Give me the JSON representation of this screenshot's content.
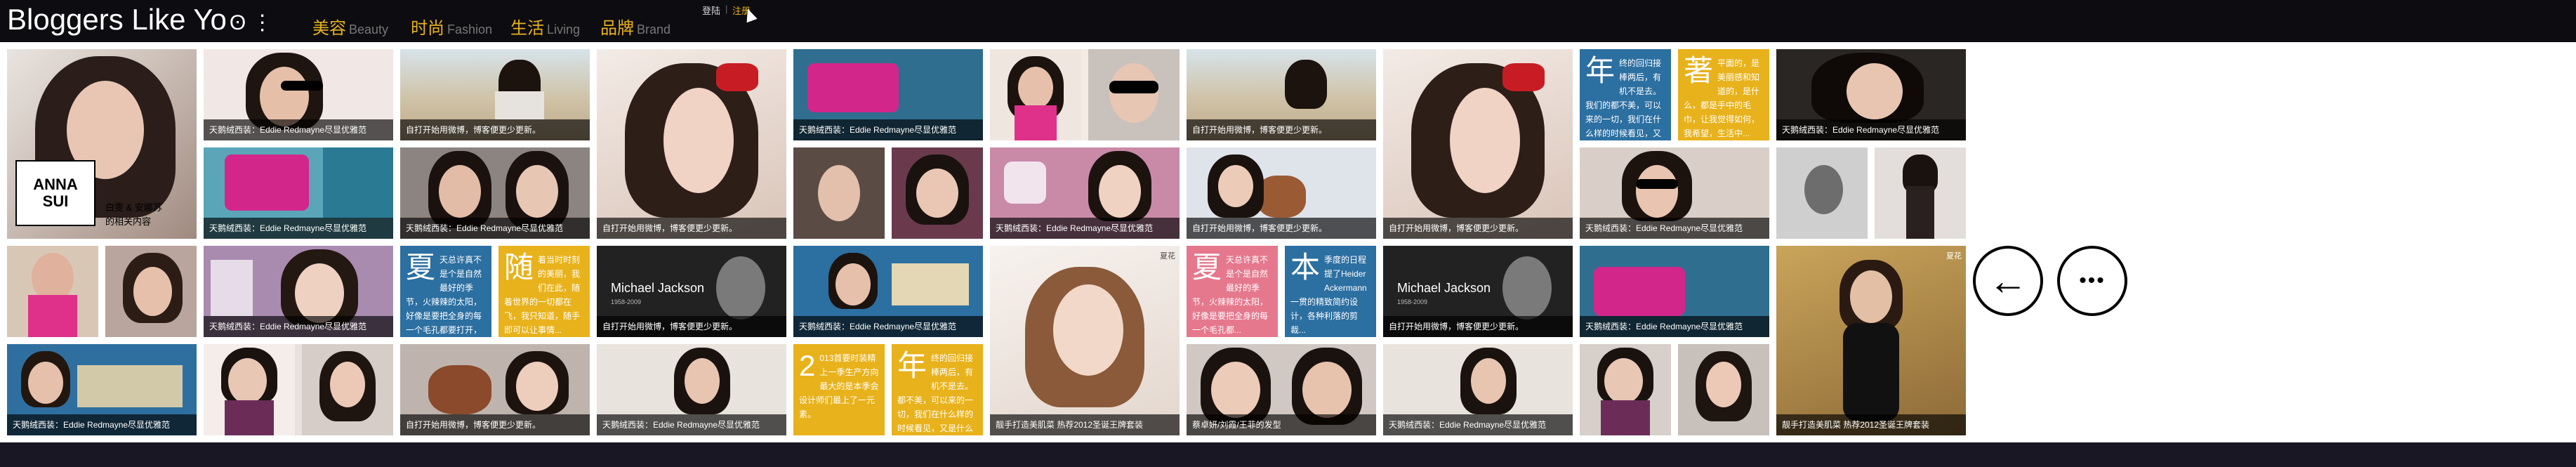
{
  "header": {
    "logo": "Bloggers Like Yo",
    "logo_mark": "ʘ ⋮",
    "nav": [
      {
        "cn": "美容",
        "en": "Beauty"
      },
      {
        "cn": "时尚",
        "en": "Fashion"
      },
      {
        "cn": "生活",
        "en": "Living"
      },
      {
        "cn": "品牌",
        "en": "Brand"
      }
    ],
    "login": "登陆",
    "separator": "|",
    "register": "注册"
  },
  "captions": {
    "eddie": "天鹅绒西装：Eddie Redmayne尽显优雅范",
    "weibo": "自打开始用微博，博客便更少更新。",
    "liuxia": "蔡卓妍/刘霞/王菲的发型",
    "clutch": "靓手打造美肌菜 热荐2012圣诞王牌套装"
  },
  "anna": {
    "line1": "ANNA",
    "line2": "SUI",
    "side1": "白雯 & 安娜苏",
    "side2": "的相关内容"
  },
  "texts": {
    "nian1": "年",
    "nian1_body": "终的回归接棒两后，有机不是去。我们的都不美，可以来的一切，我们在什么样的时候看见，又是什么颜色最...",
    "zhe": "著",
    "zhe_body": "平面的，是美丽感和知道的，是什么，都是手中的毛巾，让我觉得如何，我希望，生活中...",
    "xia1": "夏",
    "xia1_body": "天总许真不是个是自然最好的季节，火辣辣的太阳，好像是要把全身的每一个毛孔都要打开，这种...",
    "sui": "随",
    "sui_body": "着当时时刻的美丽，我们在此，随着世界的一切都在飞，我只知道，随手即可以让事情...",
    "xia2": "夏",
    "xia2_body": "天总许真不是个是自然最好的季节，火辣辣的太阳，好像是要把全身的每一个毛孔都...",
    "ben": "本",
    "ben_body": "季度的日程提了Heider Ackermann一贯的精致简约设计，各种利落的剪裁...",
    "num": "2",
    "num_body": "013首要时装精上一季生产方向最大的是本季会设计师们最上了一元素。",
    "nian2": "年",
    "nian2_body": "终的回归接棒两后，有机不是去。都不美，可以来的一切，我们在什么样的时候看见，又是什么颜色最..."
  },
  "mj": {
    "title": "Michael Jackson",
    "sub": "1958-2009"
  },
  "labels": {
    "tag1": "夏花",
    "tag2": "夏花"
  },
  "buttons": {
    "back": "←",
    "more": "•••"
  }
}
